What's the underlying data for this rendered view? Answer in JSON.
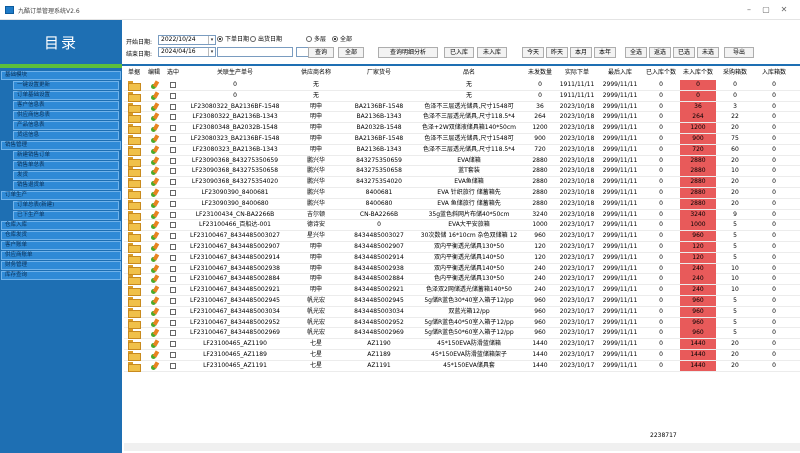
{
  "window": {
    "title": "九酷订单管理系统V2.6",
    "min": "–",
    "max": "▢",
    "close": "✕"
  },
  "sidebar": {
    "title": "目录",
    "entries": [
      {
        "kind": "group",
        "label": "基础模块"
      },
      {
        "kind": "item",
        "label": "一键设置更新"
      },
      {
        "kind": "item",
        "label": "订单基础设置"
      },
      {
        "kind": "item",
        "label": "客户信息表"
      },
      {
        "kind": "item",
        "label": "供应商信息表"
      },
      {
        "kind": "item",
        "label": "产品信息表"
      },
      {
        "kind": "item",
        "label": "货运信息"
      },
      {
        "kind": "group",
        "label": "销售管理"
      },
      {
        "kind": "item",
        "label": "新建销售订单"
      },
      {
        "kind": "item",
        "label": "销售单总表"
      },
      {
        "kind": "item",
        "label": "发货"
      },
      {
        "kind": "item",
        "label": "销售退货单"
      },
      {
        "kind": "group",
        "label": "订单生产"
      },
      {
        "kind": "item",
        "label": "订单总表(新建)"
      },
      {
        "kind": "item",
        "label": "已下生产单"
      },
      {
        "kind": "group",
        "label": "仓库入库"
      },
      {
        "kind": "group",
        "label": "仓库发货"
      },
      {
        "kind": "group",
        "label": "客户账单"
      },
      {
        "kind": "group",
        "label": "供应商账单"
      },
      {
        "kind": "group",
        "label": "财务管理"
      },
      {
        "kind": "group",
        "label": "库存查询"
      }
    ]
  },
  "toolbar": {
    "start_label": "开始日期:",
    "start_value": "2022/10/24",
    "end_label": "结束日期:",
    "end_value": "2024/04/16",
    "radio_order": "下单日期",
    "radio_ship": "出货日期",
    "radio_multi": "多层",
    "radio_all": "全部",
    "btn_query": "查询",
    "btn_all": "全部",
    "btn_query_detail": "查询明细分析",
    "btn_in": "已入库",
    "btn_not_in": "未入库",
    "btn_today": "今天",
    "btn_yesterday": "昨天",
    "btn_month": "本月",
    "btn_year": "本年",
    "btn_select_all": "全选",
    "btn_invert": "返选",
    "btn_selected": "已选",
    "btn_unselected": "未选",
    "btn_export": "导出"
  },
  "table": {
    "headers": [
      "单据",
      "编辑",
      "选中",
      "关联生产单号",
      "供应商名称",
      "厂家货号",
      "品名",
      "未发数量",
      "实际下单",
      "最后入库",
      "已入库个数",
      "未入库个数",
      "采购箱数",
      "入库箱数"
    ],
    "rows": [
      [
        "0",
        "无",
        "",
        "无",
        "0",
        "1911/11/11",
        "2999/11/11",
        "0",
        "0",
        "0",
        "0"
      ],
      [
        "0",
        "无",
        "",
        "无",
        "0",
        "1911/11/11",
        "2999/11/11",
        "0",
        "0",
        "0",
        "0"
      ],
      [
        "LF23080322_BA2136BF-1548",
        "明申",
        "BA2136BF-1548",
        "色泽不三层透光储具,尺寸1548可",
        "36",
        "2023/10/18",
        "2999/11/11",
        "0",
        "36",
        "3",
        "0"
      ],
      [
        "LF23080322_BA2136B-1343",
        "明申",
        "BA2136B-1343",
        "色泽不三层透光储具,尺寸118.5*4",
        "264",
        "2023/10/18",
        "2999/11/11",
        "0",
        "264",
        "22",
        "0"
      ],
      [
        "LF23080348_BA2032B-1548",
        "明申",
        "BA2032B-1548",
        "色泽+2W双储液储具箱140*50cm",
        "1200",
        "2023/10/18",
        "2999/11/11",
        "0",
        "1200",
        "20",
        "0"
      ],
      [
        "LF23080323_BA2136BF-1548",
        "明申",
        "BA2136BF-1548",
        "色泽不三层透光储具,尺寸1548可",
        "900",
        "2023/10/18",
        "2999/11/11",
        "0",
        "900",
        "75",
        "0"
      ],
      [
        "LF23080323_BA2136B-1343",
        "明申",
        "BA2136B-1343",
        "色泽不三层透光储具,尺寸118.5*4",
        "720",
        "2023/10/18",
        "2999/11/11",
        "0",
        "720",
        "60",
        "0"
      ],
      [
        "LF23090368_843275350659",
        "鹏兴华",
        "843275350659",
        "EVA储箱",
        "2880",
        "2023/10/18",
        "2999/11/11",
        "0",
        "2880",
        "20",
        "0"
      ],
      [
        "LF23090368_843275350658",
        "鹏兴华",
        "843275350658",
        "蓝T套装",
        "2880",
        "2023/10/18",
        "2999/11/11",
        "0",
        "2880",
        "10",
        "0"
      ],
      [
        "LF23090368_843275354020",
        "鹏兴华",
        "843275354020",
        "EVA鱼储箱",
        "2880",
        "2023/10/18",
        "2999/11/11",
        "0",
        "2880",
        "20",
        "0"
      ],
      [
        "LF23090390_8400681",
        "鹏兴华",
        "8400681",
        "EVA 针织旅行 储蓄箱先",
        "2880",
        "2023/10/18",
        "2999/11/11",
        "0",
        "2880",
        "20",
        "0"
      ],
      [
        "LF23090390_8400680",
        "鹏兴华",
        "8400680",
        "EVA 鱼储旅行 储蓄箱先",
        "2880",
        "2023/10/18",
        "2999/11/11",
        "0",
        "2880",
        "20",
        "0"
      ],
      [
        "LF23100434_CN-BA2266B",
        "吉尔顿",
        "CN-BA2266B",
        "35g蓝色斜网片布储40*50cm",
        "3240",
        "2023/10/18",
        "2999/11/11",
        "0",
        "3240",
        "9",
        "0"
      ],
      [
        "LF23100466_百船达-001",
        "德诗安",
        "0",
        "EVA大平安旅箱",
        "1000",
        "2023/10/17",
        "2999/11/11",
        "0",
        "1000",
        "5",
        "0"
      ],
      [
        "LF23100467_8434485003027",
        "星兴华",
        "8434485003027",
        "30次数储 16*10cm 杂色双储箱 12",
        "960",
        "2023/10/17",
        "2999/11/11",
        "0",
        "960",
        "5",
        "0"
      ],
      [
        "LF23100467_8434485002907",
        "明申",
        "8434485002907",
        "双内平衡透光储具130*50",
        "120",
        "2023/10/17",
        "2999/11/11",
        "0",
        "120",
        "5",
        "0"
      ],
      [
        "LF23100467_8434485002914",
        "明申",
        "8434485002914",
        "双内平衡透光储具140*50",
        "120",
        "2023/10/17",
        "2999/11/11",
        "0",
        "120",
        "5",
        "0"
      ],
      [
        "LF23100467_8434485002938",
        "明申",
        "8434485002938",
        "双内平衡透光储具140*50",
        "240",
        "2023/10/17",
        "2999/11/11",
        "0",
        "240",
        "10",
        "0"
      ],
      [
        "LF23100467_8434485002884",
        "明申",
        "8434485002884",
        "色内平衡透光储具130*50",
        "240",
        "2023/10/17",
        "2999/11/11",
        "0",
        "240",
        "10",
        "0"
      ],
      [
        "LF23100467_8434485002921",
        "明申",
        "8434485002921",
        "色泽双2网储透光储蓄箱140*50",
        "240",
        "2023/10/17",
        "2999/11/11",
        "0",
        "240",
        "10",
        "0"
      ],
      [
        "LF23100467_8434485002945",
        "帆光宏",
        "8434485002945",
        "5g储R蓝色30*40室入箱子12/pp",
        "960",
        "2023/10/17",
        "2999/11/11",
        "0",
        "960",
        "5",
        "0"
      ],
      [
        "LF23100467_8434485003034",
        "帆光宏",
        "8434485003034",
        "双蓝光箱12/pp",
        "960",
        "2023/10/17",
        "2999/11/11",
        "0",
        "960",
        "5",
        "0"
      ],
      [
        "LF23100467_8434485002952",
        "帆光宏",
        "8434485002952",
        "5g储R蓝色40*50室入箱子12/pp",
        "960",
        "2023/10/17",
        "2999/11/11",
        "0",
        "960",
        "5",
        "0"
      ],
      [
        "LF23100467_8434485002969",
        "帆光宏",
        "8434485002969",
        "5g储R蓝色50*60室入箱子12/pp",
        "960",
        "2023/10/17",
        "2999/11/11",
        "0",
        "960",
        "5",
        "0"
      ],
      [
        "LF23100465_AZ1190",
        "七星",
        "AZ1190",
        "45*150EVA防滑蓝储箱",
        "1440",
        "2023/10/17",
        "2999/11/11",
        "0",
        "1440",
        "20",
        "0"
      ],
      [
        "LF23100465_AZ1189",
        "七星",
        "AZ1189",
        "45*150EVA防滑蓝储箱架子",
        "1440",
        "2023/10/17",
        "2999/11/11",
        "0",
        "1440",
        "20",
        "0"
      ],
      [
        "LF23100465_AZ1191",
        "七星",
        "AZ1191",
        "45*150EVA储具套",
        "1440",
        "2023/10/17",
        "2999/11/11",
        "0",
        "1440",
        "20",
        "0"
      ]
    ],
    "total": "2238717"
  }
}
